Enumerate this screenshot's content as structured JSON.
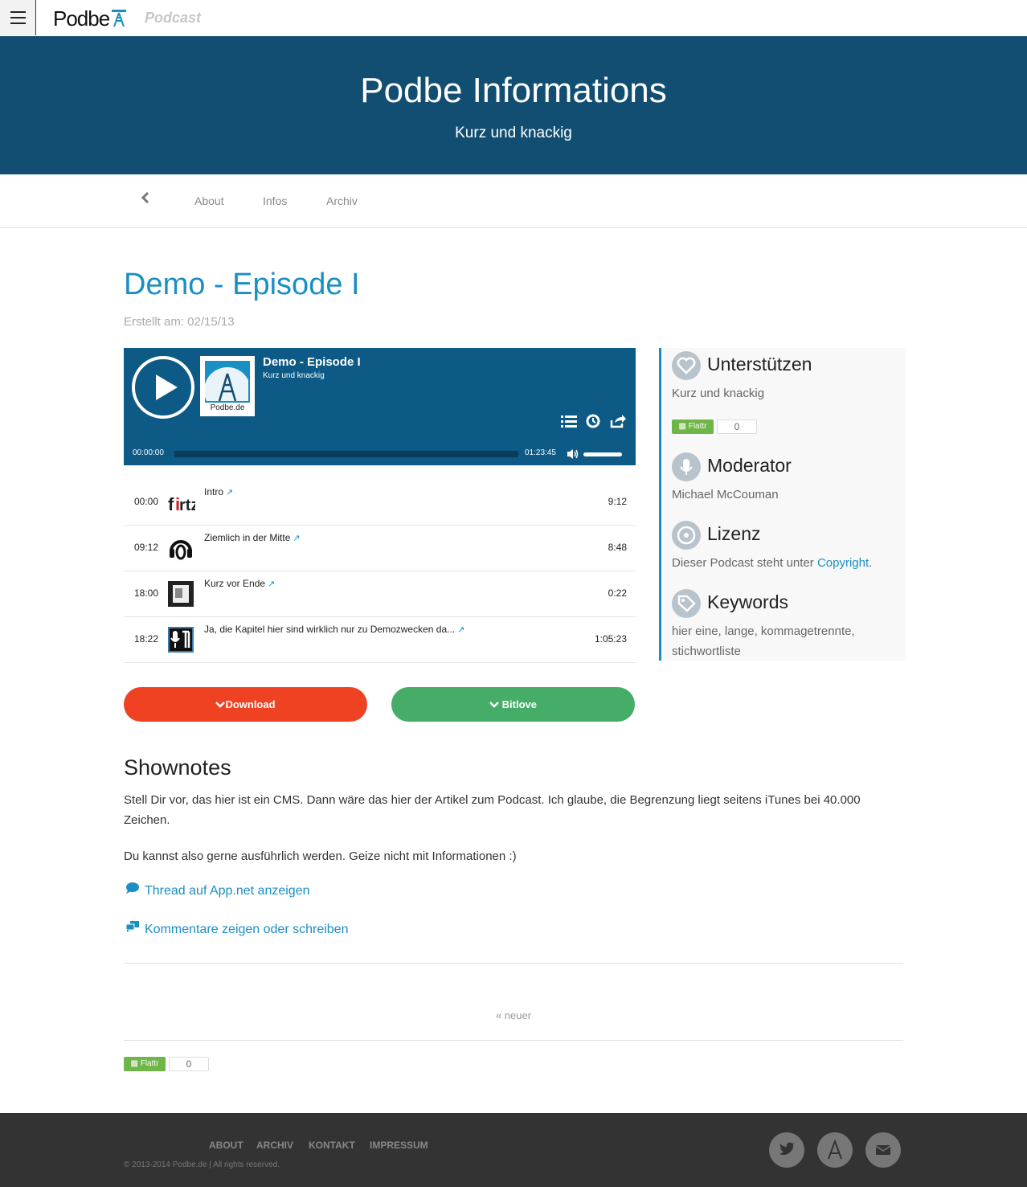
{
  "topbar": {
    "logo_text": "Podbe",
    "site_type": "Podcast"
  },
  "hero": {
    "title": "Podbe Informations",
    "tagline": "Kurz und knackig"
  },
  "nav": {
    "back": "‹",
    "items": [
      "About",
      "Infos",
      "Archiv"
    ]
  },
  "episode": {
    "title": "Demo - Episode I",
    "date": "Erstellt am: 02/15/13",
    "player": {
      "title": "Demo - Episode I",
      "subtitle": "Kurz und knackig",
      "cover_label": "Podbe.de",
      "time_current": "00:00:00",
      "time_total": "01:23:45",
      "progress": 0
    },
    "chapters": [
      {
        "start": "00:00",
        "title": "Intro",
        "duration": "9:12",
        "thumb": "firtz-logo"
      },
      {
        "start": "09:12",
        "title": "Ziemlich in der Mitte",
        "duration": "8:48",
        "thumb": "headphones-logo"
      },
      {
        "start": "18:00",
        "title": "Kurz vor Ende",
        "duration": "0:22",
        "thumb": "box-logo"
      },
      {
        "start": "18:22",
        "title": "Ja, die Kapitel hier sind wirklich nur zu Demozwecken da...",
        "duration": "1:05:23",
        "thumb": "mic-logo"
      }
    ],
    "download_label": "Download",
    "bitlove_label": "Bitlove"
  },
  "sidebar": {
    "support": {
      "heading": "Unterstützen",
      "text": "Kurz und knackig",
      "flattr_label": "Flattr",
      "flattr_count": "0"
    },
    "moderator": {
      "heading": "Moderator",
      "text": "Michael McCouman"
    },
    "license": {
      "heading": "Lizenz",
      "text": "Dieser Podcast steht unter ",
      "link": "Copyright",
      "suffix": "."
    },
    "keywords": {
      "heading": "Keywords",
      "text": "hier eine, lange, kommagetrennte, stichwortliste"
    }
  },
  "shownotes": {
    "heading": "Shownotes",
    "p1": "Stell Dir vor, das hier ist ein CMS. Dann wäre das hier der Artikel zum Podcast. Ich glaube, die Begrenzung liegt seitens iTunes bei 40.000 Zeichen.",
    "p2": "Du kannst also gerne ausführlich werden. Geize nicht mit Informationen :)",
    "link_appnet": "Thread auf App.net anzeigen",
    "link_comments": "Kommentare zeigen oder schreiben"
  },
  "pager": {
    "newer": "« neuer"
  },
  "bottom_flattr": {
    "label": "Flattr",
    "count": "0"
  },
  "footer": {
    "links": [
      "ABOUT",
      "ARCHIV",
      "KONTAKT",
      "IMPRESSUM"
    ],
    "copyright": "© 2013-2014 Podbe.de | All rights reserved.",
    "social": [
      "twitter-icon",
      "appnet-icon",
      "email-icon"
    ]
  },
  "colors": {
    "hero": "#124e72",
    "accent": "#1a8fc4",
    "download": "#ef4223",
    "bitlove": "#45ad68",
    "player": "#0c5a85",
    "footer": "#333333"
  }
}
